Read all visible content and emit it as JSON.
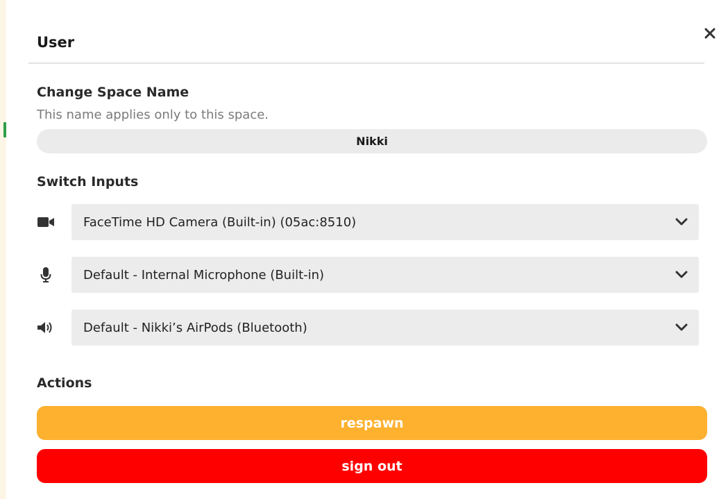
{
  "header": {
    "title": "User",
    "close_icon": "close-icon"
  },
  "space_name": {
    "title": "Change Space Name",
    "subtitle": "This name applies only to this space.",
    "value": "Nikki"
  },
  "switch_inputs": {
    "title": "Switch Inputs",
    "camera": {
      "icon": "camera-icon",
      "selected": "FaceTime HD Camera (Built-in) (05ac:8510)"
    },
    "microphone": {
      "icon": "microphone-icon",
      "selected": "Default - Internal Microphone (Built-in)"
    },
    "speaker": {
      "icon": "speaker-icon",
      "selected": "Default - Nikki’s AirPods (Bluetooth)"
    }
  },
  "actions": {
    "title": "Actions",
    "respawn_label": "respawn",
    "sign_out_label": "sign out"
  },
  "colors": {
    "respawn": "#fdb12f",
    "sign_out": "#ff0000",
    "field_background": "#ececec"
  }
}
